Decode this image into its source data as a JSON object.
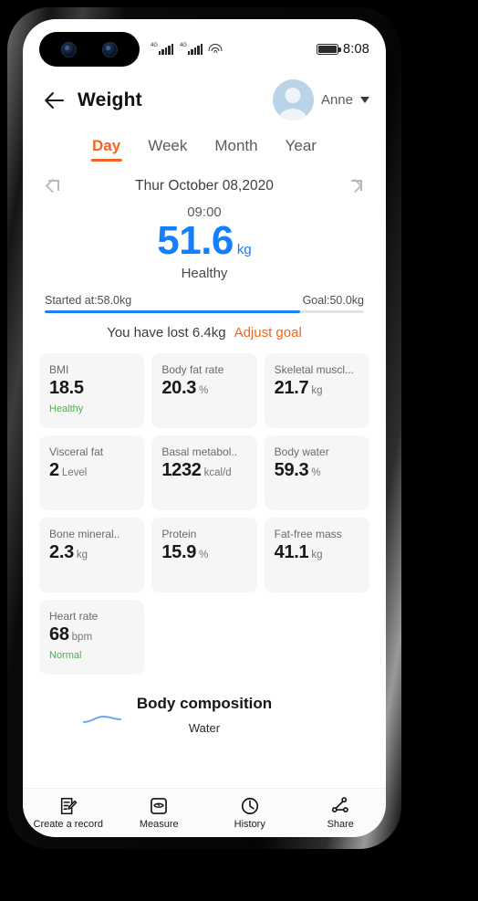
{
  "status_bar": {
    "network_1": "4G",
    "network_2": "4G",
    "wifi_icon": "wifi-icon",
    "battery_icon": "battery-icon",
    "clock": "8:08"
  },
  "header": {
    "back_icon": "back-arrow-icon",
    "title": "Weight",
    "avatar_icon": "avatar",
    "profile_name": "Anne",
    "dropdown_icon": "chevron-down-icon"
  },
  "tabs": [
    {
      "label": "Day",
      "active": true
    },
    {
      "label": "Week",
      "active": false
    },
    {
      "label": "Month",
      "active": false
    },
    {
      "label": "Year",
      "active": false
    }
  ],
  "date_selector": {
    "prev_icon": "chevron-left-icon",
    "label": "Thur October 08,2020",
    "next_icon": "chevron-right-icon"
  },
  "weight": {
    "time": "09:00",
    "value": "51.6",
    "unit": "kg",
    "status": "Healthy",
    "value_color": "#157efb"
  },
  "goal": {
    "start_label": "Started at:58.0kg",
    "goal_label": "Goal:50.0kg",
    "progress_percent": 80,
    "progress_color": "#1a82f7",
    "summary": "You have lost 6.4kg",
    "adjust_label": "Adjust goal",
    "adjust_color": "#f06521"
  },
  "metrics": [
    {
      "name": "BMI",
      "value": "18.5",
      "unit": "",
      "status": "Healthy"
    },
    {
      "name": "Body fat rate",
      "value": "20.3",
      "unit": "%",
      "status": ""
    },
    {
      "name": "Skeletal muscl...",
      "value": "21.7",
      "unit": "kg",
      "status": ""
    },
    {
      "name": "Visceral fat",
      "value": "2",
      "unit": "Level",
      "status": ""
    },
    {
      "name": "Basal metabol..",
      "value": "1232",
      "unit": "kcal/d",
      "status": ""
    },
    {
      "name": "Body water",
      "value": "59.3",
      "unit": "%",
      "status": ""
    },
    {
      "name": "Bone mineral..",
      "value": "2.3",
      "unit": "kg",
      "status": ""
    },
    {
      "name": "Protein",
      "value": "15.9",
      "unit": "%",
      "status": ""
    },
    {
      "name": "Fat-free mass",
      "value": "41.1",
      "unit": "kg",
      "status": ""
    },
    {
      "name": "Heart rate",
      "value": "68",
      "unit": "bpm",
      "status": "Normal"
    }
  ],
  "body_composition": {
    "title": "Body composition",
    "legend_label": "Water"
  },
  "bottom_nav": [
    {
      "label": "Create a record",
      "icon": "note-edit-icon"
    },
    {
      "label": "Measure",
      "icon": "scale-icon"
    },
    {
      "label": "History",
      "icon": "clock-icon"
    },
    {
      "label": "Share",
      "icon": "share-icon"
    }
  ]
}
